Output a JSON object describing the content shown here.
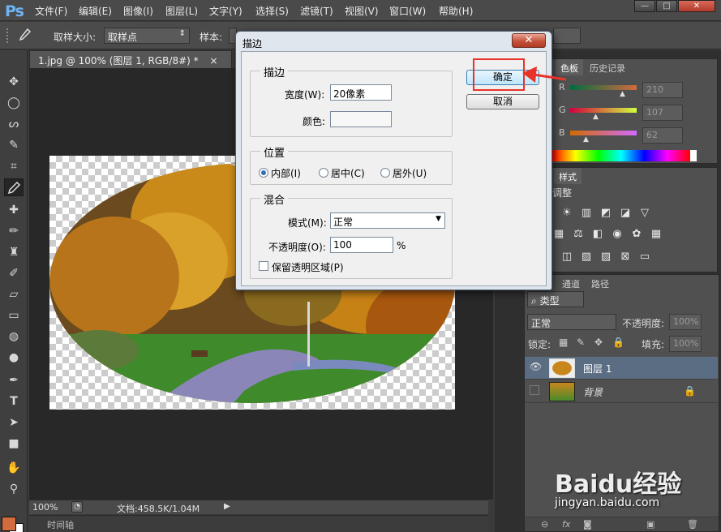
{
  "app": {
    "logo": "Ps"
  },
  "menu": [
    "文件(F)",
    "编辑(E)",
    "图像(I)",
    "图层(L)",
    "文字(Y)",
    "选择(S)",
    "滤镜(T)",
    "视图(V)",
    "窗口(W)",
    "帮助(H)"
  ],
  "window_controls": {
    "minimize": "—",
    "maximize": "□",
    "close": "✕"
  },
  "options": {
    "sample_size_label": "取样大小:",
    "sample_size_value": "取样点",
    "sample_label": "样本:"
  },
  "document": {
    "tab_title": "1.jpg @ 100% (图层 1, RGB/8#) *",
    "tab_close": "×"
  },
  "status": {
    "zoom": "100%",
    "doc_info": "文档:458.5K/1.04M",
    "timeline": "时间轴"
  },
  "color_panel": {
    "tabs": [
      "色板",
      "历史记录"
    ],
    "channels": [
      {
        "label": "R",
        "value": "210"
      },
      {
        "label": "G",
        "value": "107"
      },
      {
        "label": "B",
        "value": "62"
      }
    ]
  },
  "adjust_panel": {
    "tab": "样式",
    "title": "调整"
  },
  "layers_panel": {
    "tabs": [
      "通道",
      "路径"
    ],
    "filter_kind": "类型",
    "blend_mode": "正常",
    "opacity_label": "不透明度:",
    "opacity_value": "100%",
    "lock_label": "锁定:",
    "fill_label": "填充:",
    "fill_value": "100%",
    "layers": [
      {
        "name": "图层 1"
      },
      {
        "name": "背景"
      }
    ]
  },
  "dialog": {
    "title": "描边",
    "close_label": "✕",
    "stroke_group": "描边",
    "width_label": "宽度(W):",
    "width_value": "20像素",
    "color_label": "颜色:",
    "position_group": "位置",
    "position_options": [
      "内部(I)",
      "居中(C)",
      "居外(U)"
    ],
    "blend_group": "混合",
    "mode_label": "模式(M):",
    "mode_value": "正常",
    "opacity_label": "不透明度(O):",
    "opacity_value": "100",
    "opacity_unit": "%",
    "preserve_label": "保留透明区域(P)",
    "ok_label": "确定",
    "cancel_label": "取消"
  },
  "watermark": {
    "brand": "Baidu经验",
    "url": "jingyan.baidu.com"
  },
  "colors": {
    "foreground": "#d26b3e",
    "accent_red": "#e8332a",
    "selected_layer": "#5b6d82"
  }
}
